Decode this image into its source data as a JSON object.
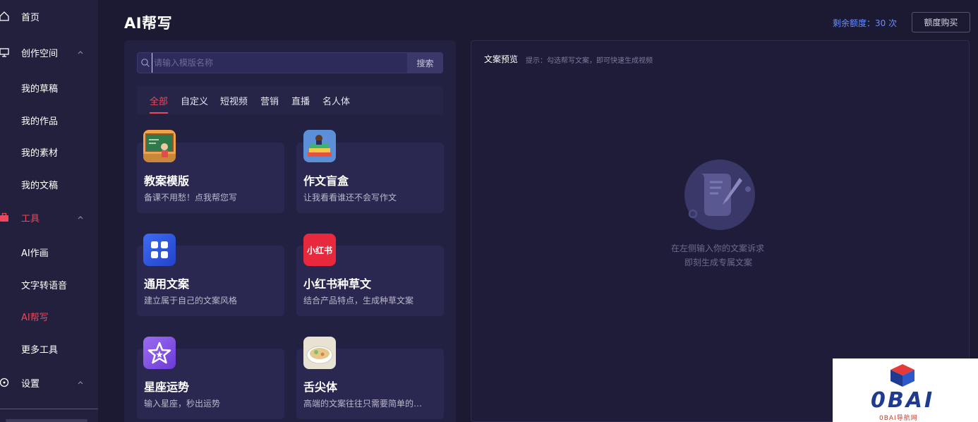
{
  "sidebar": {
    "items": [
      {
        "label": "首页",
        "icon": "home-icon"
      },
      {
        "label": "创作空间",
        "icon": "monitor-icon"
      },
      {
        "label": "我的草稿"
      },
      {
        "label": "我的作品"
      },
      {
        "label": "我的素材"
      },
      {
        "label": "我的文稿"
      },
      {
        "label": "工具",
        "icon": "toolbox-icon"
      },
      {
        "label": "AI作画"
      },
      {
        "label": "文字转语音"
      },
      {
        "label": "AI帮写"
      },
      {
        "label": "更多工具"
      },
      {
        "label": "设置",
        "icon": "settings-icon"
      }
    ]
  },
  "header": {
    "title": "AI帮写",
    "quota_text": "剩余额度：30 次",
    "buy_label": "额度购买"
  },
  "search": {
    "placeholder": "请输入模版名称",
    "button_label": "搜索"
  },
  "tabs": [
    {
      "label": "全部"
    },
    {
      "label": "自定义"
    },
    {
      "label": "短视频"
    },
    {
      "label": "营销"
    },
    {
      "label": "直播"
    },
    {
      "label": "名人体"
    }
  ],
  "cards": [
    {
      "title": "教案模版",
      "desc": "备课不用愁！点我帮您写",
      "icon": "classroom-icon"
    },
    {
      "title": "作文盲盒",
      "desc": "让我看看谁还不会写作文",
      "icon": "books-icon"
    },
    {
      "title": "通用文案",
      "desc": "建立属于自己的文案风格",
      "icon": "grid-apps-icon"
    },
    {
      "title": "小红书种草文",
      "desc": "结合产品特点，生成种草文案",
      "icon": "xiaohongshu-icon",
      "icon_text": "小红书"
    },
    {
      "title": "星座运势",
      "desc": "输入星座，秒出运势",
      "icon": "star-icon"
    },
    {
      "title": "舌尖体",
      "desc": "高端的文案往往只需要简单的…",
      "icon": "food-bowl-icon"
    }
  ],
  "preview": {
    "label": "文案预览",
    "hint": "提示：勾选帮写文案，即可快速生成视频",
    "empty_line1": "在左侧输入你的文案诉求",
    "empty_line2": "即刻生成专属文案"
  },
  "watermark": {
    "text": "0BAI",
    "sub": "0BAI导航网"
  },
  "colors": {
    "accent": "#f0465a",
    "link": "#6b8cff",
    "background": "#1b1a32"
  }
}
